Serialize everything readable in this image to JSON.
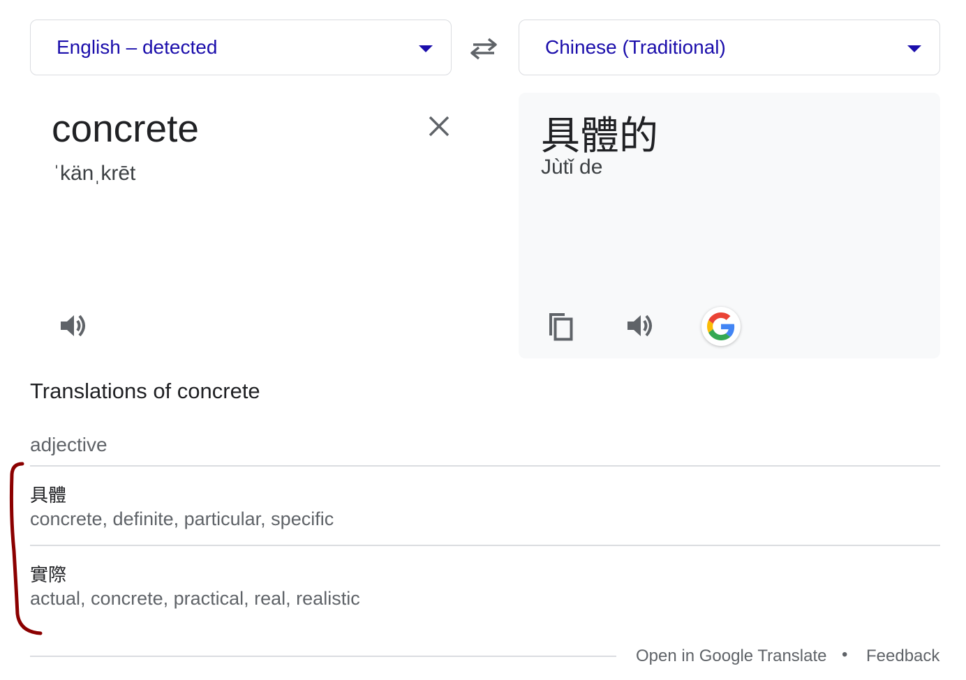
{
  "source_language": {
    "label": "English – detected"
  },
  "target_language": {
    "label": "Chinese (Traditional)"
  },
  "source": {
    "text": "concrete",
    "phonetic": "ˈkänˌkrēt"
  },
  "target": {
    "text": "具體的",
    "romanization": "Jùtǐ de"
  },
  "translations": {
    "heading": "Translations of concrete",
    "part_of_speech": "adjective",
    "entries": [
      {
        "term": "具體",
        "synonyms": "concrete, definite, particular, specific"
      },
      {
        "term": "實際",
        "synonyms": "actual, concrete, practical, real, realistic"
      }
    ]
  },
  "footer": {
    "open_link": "Open in Google Translate",
    "separator": "•",
    "feedback": "Feedback"
  },
  "colors": {
    "link": "#1a0dab",
    "annotation": "#8b0000"
  }
}
